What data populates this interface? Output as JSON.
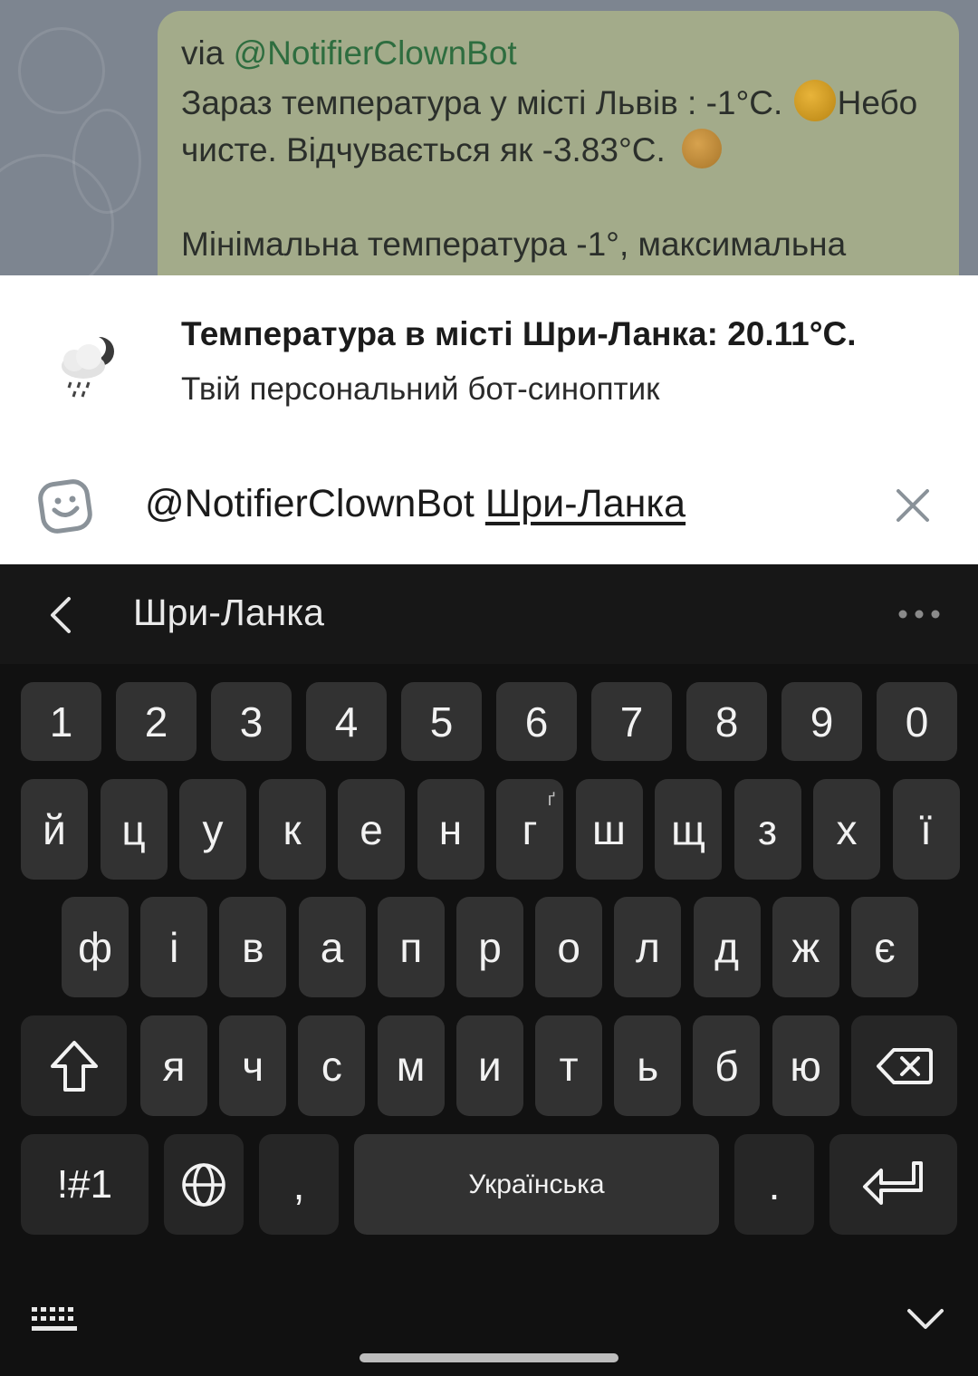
{
  "chat": {
    "via_prefix": "via",
    "bot_name": "@NotifierClownBot",
    "line1_a": "Зараз температура у місті Львів : -1°C.",
    "line1_b": "Небо",
    "line2": "чисте. Відчувається як -3.83°C.",
    "line3": "Мінімальна температура -1°, максимальна"
  },
  "result": {
    "icon": "weather-cloud-moon-rain-icon",
    "title": "Температура в місті Шри-Ланка: 20.11°C.",
    "description": "Твій персональний бот-синоптик"
  },
  "input": {
    "bot_mention": "@NotifierClownBot",
    "query": "Шри-Ланка"
  },
  "keyboard": {
    "suggestion": "Шри-Ланка",
    "numbers": [
      "1",
      "2",
      "3",
      "4",
      "5",
      "6",
      "7",
      "8",
      "9",
      "0"
    ],
    "row1": [
      "й",
      "ц",
      "у",
      "к",
      "е",
      "н",
      "г",
      "ш",
      "щ",
      "з",
      "х",
      "ї"
    ],
    "row1_sub_g": "ґ",
    "row2": [
      "ф",
      "і",
      "в",
      "а",
      "п",
      "р",
      "о",
      "л",
      "д",
      "ж",
      "є"
    ],
    "row3": [
      "я",
      "ч",
      "с",
      "м",
      "и",
      "т",
      "ь",
      "б",
      "ю"
    ],
    "symbols_label": "!#1",
    "comma": ",",
    "space_label": "Українська",
    "period": "."
  }
}
